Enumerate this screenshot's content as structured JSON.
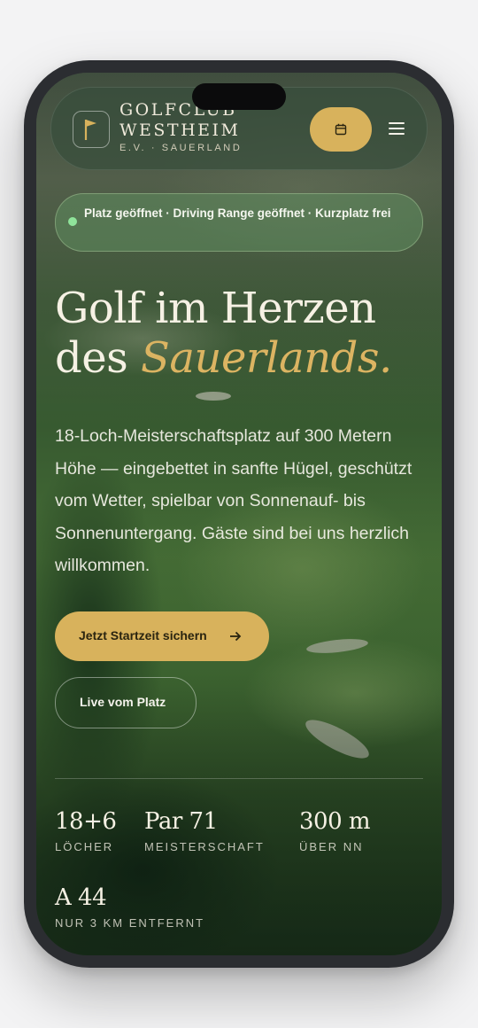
{
  "header": {
    "brand_line1": "GOLFCLUB",
    "brand_line2": "WESTHEIM",
    "brand_sub": "E.V. · SAUERLAND",
    "logo_icon": "golf-flag-icon",
    "calendar_icon": "calendar-icon",
    "menu_icon": "menu-icon"
  },
  "status": {
    "text": "Platz geöffnet · Driving Range geöffnet · Kurzplatz frei",
    "indicator_color": "#8fe39a"
  },
  "hero": {
    "headline_part1": "Golf im Herzen",
    "headline_part2": "des ",
    "headline_accent": "Sauerlands.",
    "lead": "18-Loch-Meisterschaftsplatz auf 300 Metern Höhe — eingebettet in sanfte Hügel, geschützt vom Wetter, spielbar von Sonnenauf- bis Sonnenuntergang. Gäste sind bei uns herzlich willkommen.",
    "primary_cta": "Jetzt Startzeit sichern",
    "primary_cta_icon": "arrow-right-icon",
    "secondary_cta": "Live vom Platz"
  },
  "stats": [
    {
      "value": "18+6",
      "caption": "LÖCHER"
    },
    {
      "value": "Par 71",
      "caption": "MEISTERSCHAFT"
    },
    {
      "value": "300 m",
      "caption": "ÜBER NN"
    },
    {
      "value": "A 44",
      "caption": "NUR 3 KM ENTFERNT"
    }
  ],
  "colors": {
    "accent": "#d8b25c",
    "accent_text": "#dcb462",
    "text_light": "#f6f1e4"
  }
}
